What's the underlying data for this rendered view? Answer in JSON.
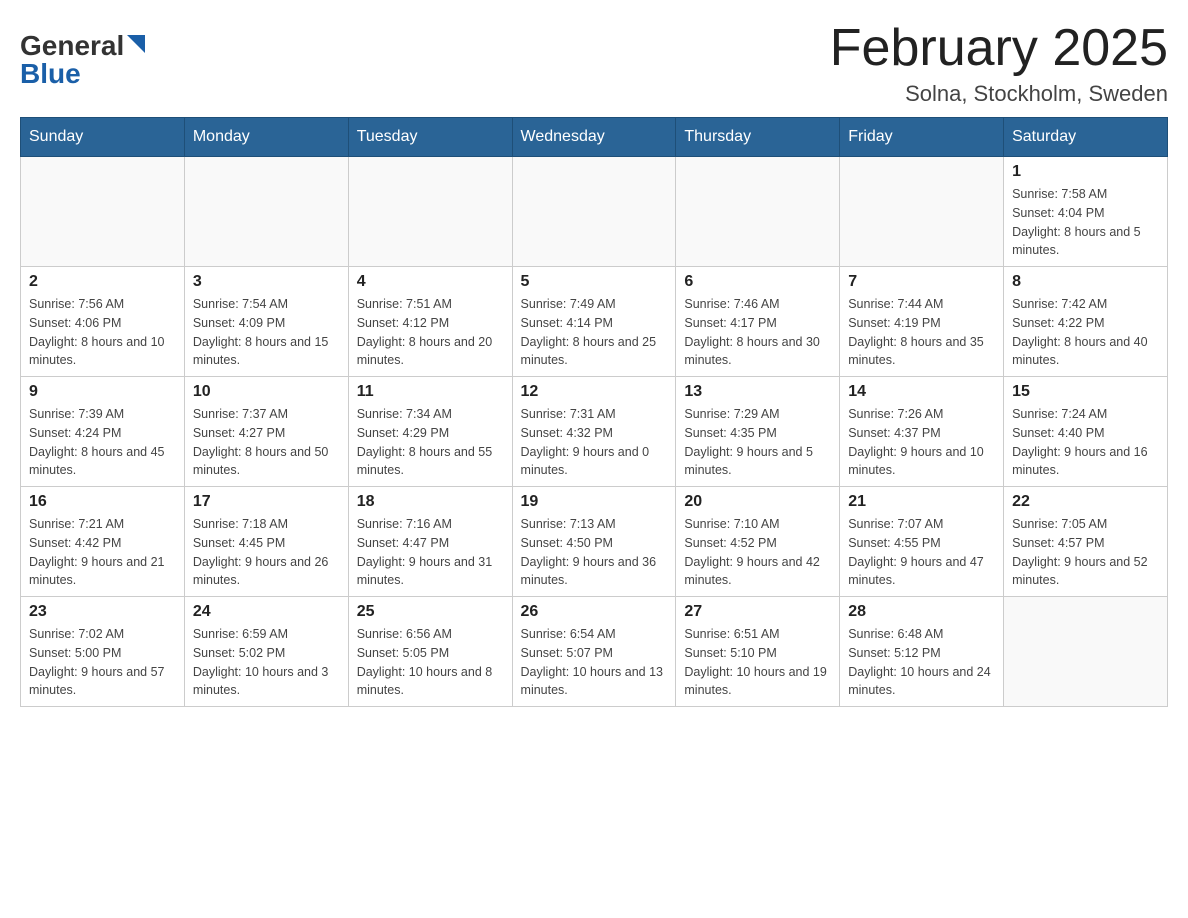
{
  "header": {
    "logo_general": "General",
    "logo_blue": "Blue",
    "title": "February 2025",
    "location": "Solna, Stockholm, Sweden"
  },
  "weekdays": [
    "Sunday",
    "Monday",
    "Tuesday",
    "Wednesday",
    "Thursday",
    "Friday",
    "Saturday"
  ],
  "weeks": [
    [
      {
        "day": "",
        "sunrise": "",
        "sunset": "",
        "daylight": ""
      },
      {
        "day": "",
        "sunrise": "",
        "sunset": "",
        "daylight": ""
      },
      {
        "day": "",
        "sunrise": "",
        "sunset": "",
        "daylight": ""
      },
      {
        "day": "",
        "sunrise": "",
        "sunset": "",
        "daylight": ""
      },
      {
        "day": "",
        "sunrise": "",
        "sunset": "",
        "daylight": ""
      },
      {
        "day": "",
        "sunrise": "",
        "sunset": "",
        "daylight": ""
      },
      {
        "day": "1",
        "sunrise": "Sunrise: 7:58 AM",
        "sunset": "Sunset: 4:04 PM",
        "daylight": "Daylight: 8 hours and 5 minutes."
      }
    ],
    [
      {
        "day": "2",
        "sunrise": "Sunrise: 7:56 AM",
        "sunset": "Sunset: 4:06 PM",
        "daylight": "Daylight: 8 hours and 10 minutes."
      },
      {
        "day": "3",
        "sunrise": "Sunrise: 7:54 AM",
        "sunset": "Sunset: 4:09 PM",
        "daylight": "Daylight: 8 hours and 15 minutes."
      },
      {
        "day": "4",
        "sunrise": "Sunrise: 7:51 AM",
        "sunset": "Sunset: 4:12 PM",
        "daylight": "Daylight: 8 hours and 20 minutes."
      },
      {
        "day": "5",
        "sunrise": "Sunrise: 7:49 AM",
        "sunset": "Sunset: 4:14 PM",
        "daylight": "Daylight: 8 hours and 25 minutes."
      },
      {
        "day": "6",
        "sunrise": "Sunrise: 7:46 AM",
        "sunset": "Sunset: 4:17 PM",
        "daylight": "Daylight: 8 hours and 30 minutes."
      },
      {
        "day": "7",
        "sunrise": "Sunrise: 7:44 AM",
        "sunset": "Sunset: 4:19 PM",
        "daylight": "Daylight: 8 hours and 35 minutes."
      },
      {
        "day": "8",
        "sunrise": "Sunrise: 7:42 AM",
        "sunset": "Sunset: 4:22 PM",
        "daylight": "Daylight: 8 hours and 40 minutes."
      }
    ],
    [
      {
        "day": "9",
        "sunrise": "Sunrise: 7:39 AM",
        "sunset": "Sunset: 4:24 PM",
        "daylight": "Daylight: 8 hours and 45 minutes."
      },
      {
        "day": "10",
        "sunrise": "Sunrise: 7:37 AM",
        "sunset": "Sunset: 4:27 PM",
        "daylight": "Daylight: 8 hours and 50 minutes."
      },
      {
        "day": "11",
        "sunrise": "Sunrise: 7:34 AM",
        "sunset": "Sunset: 4:29 PM",
        "daylight": "Daylight: 8 hours and 55 minutes."
      },
      {
        "day": "12",
        "sunrise": "Sunrise: 7:31 AM",
        "sunset": "Sunset: 4:32 PM",
        "daylight": "Daylight: 9 hours and 0 minutes."
      },
      {
        "day": "13",
        "sunrise": "Sunrise: 7:29 AM",
        "sunset": "Sunset: 4:35 PM",
        "daylight": "Daylight: 9 hours and 5 minutes."
      },
      {
        "day": "14",
        "sunrise": "Sunrise: 7:26 AM",
        "sunset": "Sunset: 4:37 PM",
        "daylight": "Daylight: 9 hours and 10 minutes."
      },
      {
        "day": "15",
        "sunrise": "Sunrise: 7:24 AM",
        "sunset": "Sunset: 4:40 PM",
        "daylight": "Daylight: 9 hours and 16 minutes."
      }
    ],
    [
      {
        "day": "16",
        "sunrise": "Sunrise: 7:21 AM",
        "sunset": "Sunset: 4:42 PM",
        "daylight": "Daylight: 9 hours and 21 minutes."
      },
      {
        "day": "17",
        "sunrise": "Sunrise: 7:18 AM",
        "sunset": "Sunset: 4:45 PM",
        "daylight": "Daylight: 9 hours and 26 minutes."
      },
      {
        "day": "18",
        "sunrise": "Sunrise: 7:16 AM",
        "sunset": "Sunset: 4:47 PM",
        "daylight": "Daylight: 9 hours and 31 minutes."
      },
      {
        "day": "19",
        "sunrise": "Sunrise: 7:13 AM",
        "sunset": "Sunset: 4:50 PM",
        "daylight": "Daylight: 9 hours and 36 minutes."
      },
      {
        "day": "20",
        "sunrise": "Sunrise: 7:10 AM",
        "sunset": "Sunset: 4:52 PM",
        "daylight": "Daylight: 9 hours and 42 minutes."
      },
      {
        "day": "21",
        "sunrise": "Sunrise: 7:07 AM",
        "sunset": "Sunset: 4:55 PM",
        "daylight": "Daylight: 9 hours and 47 minutes."
      },
      {
        "day": "22",
        "sunrise": "Sunrise: 7:05 AM",
        "sunset": "Sunset: 4:57 PM",
        "daylight": "Daylight: 9 hours and 52 minutes."
      }
    ],
    [
      {
        "day": "23",
        "sunrise": "Sunrise: 7:02 AM",
        "sunset": "Sunset: 5:00 PM",
        "daylight": "Daylight: 9 hours and 57 minutes."
      },
      {
        "day": "24",
        "sunrise": "Sunrise: 6:59 AM",
        "sunset": "Sunset: 5:02 PM",
        "daylight": "Daylight: 10 hours and 3 minutes."
      },
      {
        "day": "25",
        "sunrise": "Sunrise: 6:56 AM",
        "sunset": "Sunset: 5:05 PM",
        "daylight": "Daylight: 10 hours and 8 minutes."
      },
      {
        "day": "26",
        "sunrise": "Sunrise: 6:54 AM",
        "sunset": "Sunset: 5:07 PM",
        "daylight": "Daylight: 10 hours and 13 minutes."
      },
      {
        "day": "27",
        "sunrise": "Sunrise: 6:51 AM",
        "sunset": "Sunset: 5:10 PM",
        "daylight": "Daylight: 10 hours and 19 minutes."
      },
      {
        "day": "28",
        "sunrise": "Sunrise: 6:48 AM",
        "sunset": "Sunset: 5:12 PM",
        "daylight": "Daylight: 10 hours and 24 minutes."
      },
      {
        "day": "",
        "sunrise": "",
        "sunset": "",
        "daylight": ""
      }
    ]
  ]
}
